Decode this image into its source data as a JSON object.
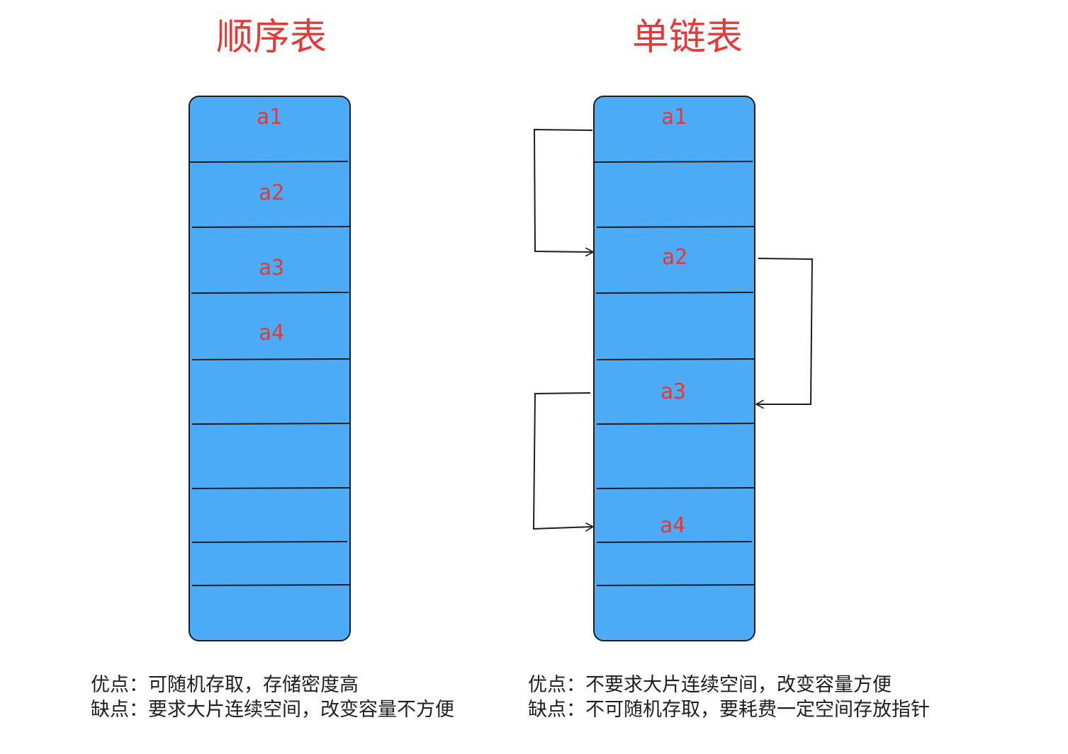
{
  "sequential": {
    "title": "顺序表",
    "cells": [
      "a1",
      "a2",
      "a3",
      "a4"
    ],
    "pros": "优点：可随机存取，存储密度高",
    "cons": "缺点：要求大片连续空间，改变容量不方便"
  },
  "linked": {
    "title": "单链表",
    "cells": [
      "a1",
      "a2",
      "a3",
      "a4"
    ],
    "pros": "优点：不要求大片连续空间，改变容量方便",
    "cons": "缺点：不可随机存取，要耗费一定空间存放指针"
  },
  "colors": {
    "block_fill": "#4dabf7",
    "block_stroke": "#1e1e1e",
    "label": "#e03a3a",
    "title": "#e03a3a"
  }
}
